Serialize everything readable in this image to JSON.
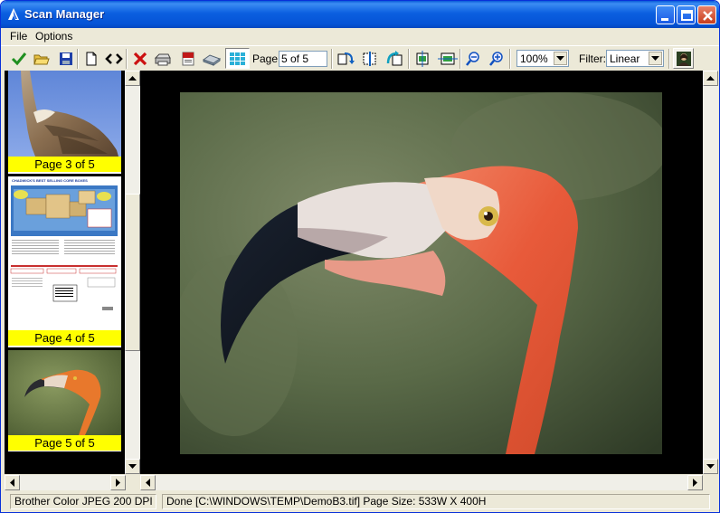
{
  "window": {
    "title": "Scan Manager"
  },
  "menu": {
    "items": [
      "File",
      "Options"
    ]
  },
  "toolbar": {
    "page_label": "Page:",
    "page_value": "5 of 5",
    "zoom_value": "100%",
    "filter_label": "Filter:",
    "filter_value": "Linear"
  },
  "thumbnails": [
    {
      "caption": "Page 3 of 5"
    },
    {
      "caption": "Page 4 of 5"
    },
    {
      "caption": "Page 5 of 5"
    }
  ],
  "document_thumb": {
    "headline": "CHADWICK'S BEST SELLING CORE BOXES"
  },
  "status": {
    "scanner": "Brother Color JPEG 200 DPI",
    "message": "Done  [C:\\WINDOWS\\TEMP\\DemoB3.tif]      Page Size: 533W X 400H"
  },
  "colors": {
    "title_bar": "#0553d6",
    "caption_bg": "#ffff00",
    "viewer_bg": "#000000"
  }
}
